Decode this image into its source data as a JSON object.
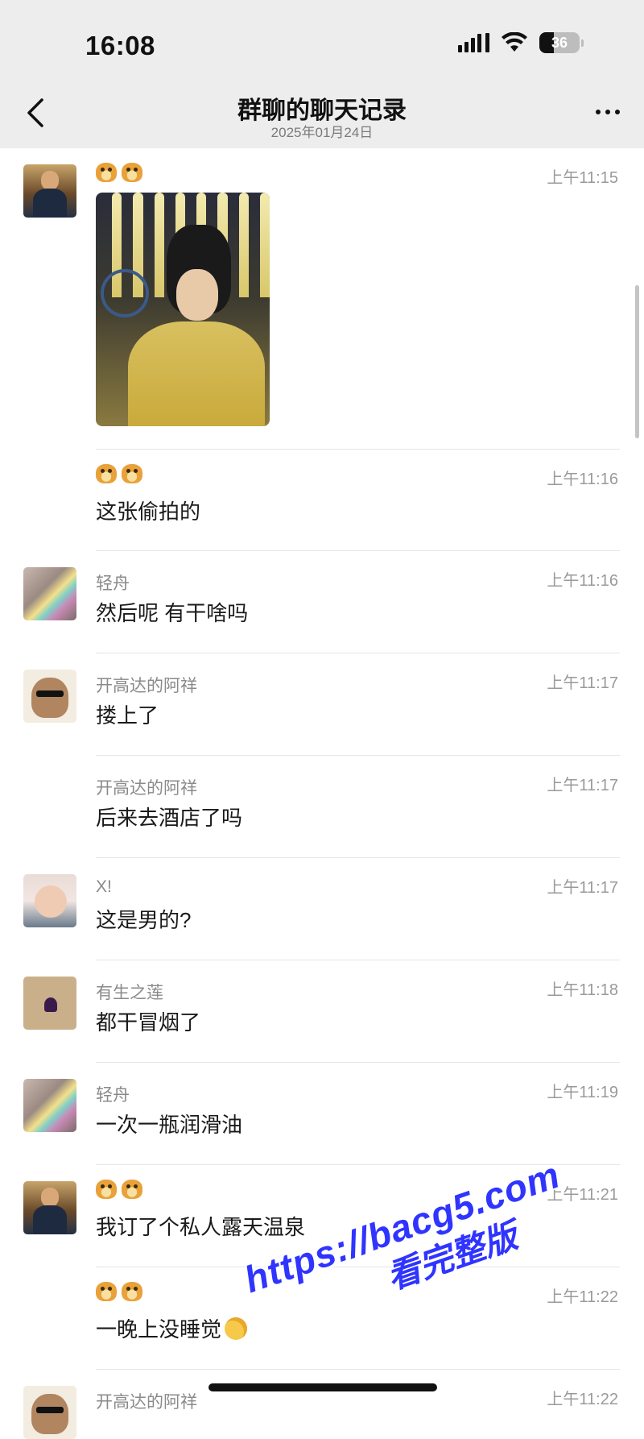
{
  "status_bar": {
    "time": "16:08",
    "battery": "36"
  },
  "nav": {
    "title": "群聊的聊天记录",
    "subtitle": "2025年01月24日"
  },
  "messages": [
    {
      "sender": "",
      "sender_emoji": true,
      "time": "上午11:15",
      "text": "",
      "has_photo": true
    },
    {
      "sender": "",
      "sender_emoji": true,
      "time": "上午11:16",
      "text": "这张偷拍的"
    },
    {
      "sender": "轻舟",
      "time": "上午11:16",
      "text": "然后呢 有干啥吗"
    },
    {
      "sender": "开高达的阿祥",
      "time": "上午11:17",
      "text": "搂上了"
    },
    {
      "sender": "开高达的阿祥",
      "time": "上午11:17",
      "text": "后来去酒店了吗"
    },
    {
      "sender": "X!",
      "time": "上午11:17",
      "text": "这是男的?"
    },
    {
      "sender": "有生之莲",
      "time": "上午11:18",
      "text": "都干冒烟了"
    },
    {
      "sender": "轻舟",
      "time": "上午11:19",
      "text": "一次一瓶润滑油"
    },
    {
      "sender": "",
      "sender_emoji": true,
      "time": "上午11:21",
      "text": "我订了个私人露天温泉"
    },
    {
      "sender": "",
      "sender_emoji": true,
      "time": "上午11:22",
      "text": "一晚上没睡觉"
    },
    {
      "sender": "开高达的阿祥",
      "time": "上午11:22",
      "text": ""
    }
  ],
  "watermark": {
    "url": "https://bacg5.com",
    "label": "看完整版"
  }
}
